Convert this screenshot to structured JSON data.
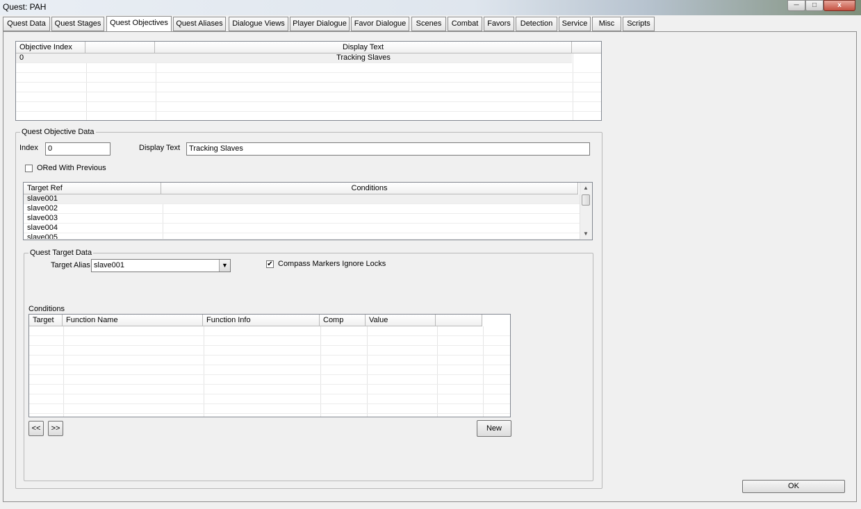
{
  "window": {
    "title": "Quest: PAH",
    "close_glyph": "x"
  },
  "tabs": [
    "Quest Data",
    "Quest Stages",
    "Quest Objectives",
    "Quest Aliases",
    "Dialogue Views",
    "Player Dialogue",
    "Favor Dialogue",
    "Scenes",
    "Combat",
    "Favors",
    "Detection",
    "Service",
    "Misc",
    "Scripts"
  ],
  "active_tab": "Quest Objectives",
  "objectives_table": {
    "columns": [
      "Objective Index",
      "",
      "Display Text",
      ""
    ],
    "rows": [
      {
        "index": "0",
        "display_text": "Tracking Slaves"
      }
    ]
  },
  "objective_data": {
    "group_label": "Quest Objective Data",
    "index_label": "Index",
    "index_value": "0",
    "display_text_label": "Display Text",
    "display_text_value": "Tracking Slaves",
    "ored_label": "ORed With Previous",
    "ored_checked": false
  },
  "targets_table": {
    "columns": [
      "Target Ref",
      "Conditions"
    ],
    "rows": [
      "slave001",
      "slave002",
      "slave003",
      "slave004",
      "slave005"
    ]
  },
  "target_data": {
    "group_label": "Quest Target Data",
    "alias_label": "Target Alias",
    "alias_value": "slave001",
    "compass_label": "Compass Markers Ignore Locks",
    "compass_checked": true,
    "conditions_label": "Conditions",
    "conditions_columns": [
      "Target",
      "Function Name",
      "Function Info",
      "Comp",
      "Value",
      ""
    ],
    "prev_label": "<<",
    "next_label": ">>",
    "new_label": "New"
  },
  "ok_label": "OK",
  "colors": {
    "selected_row": "#f0f0f0",
    "border": "#828790"
  }
}
